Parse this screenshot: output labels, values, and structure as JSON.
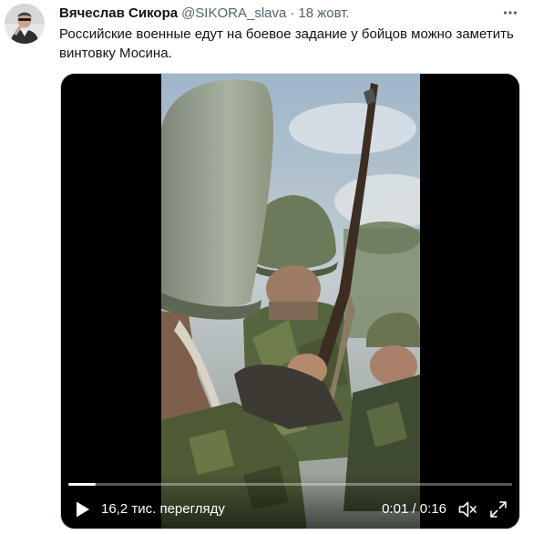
{
  "tweet": {
    "display_name": "Вячеслав Сикора",
    "handle": "@SIKORA_slava",
    "separator": "·",
    "time": "18 жовт.",
    "text": "Российские военные едут на боевое задание у бойцов можно заметить винтовку Мосина."
  },
  "video": {
    "views": "16,2 тис. перегляду",
    "timecode": "0:01 / 0:16",
    "progress": 0.0625
  },
  "icons": {
    "more": "more-icon",
    "play": "play-icon",
    "mute": "volume-muted-icon",
    "fullscreen": "fullscreen-icon"
  },
  "colors": {
    "text": "#0f1419",
    "secondary": "#536471",
    "media_background": "#000000",
    "control_text": "#ffffff"
  }
}
